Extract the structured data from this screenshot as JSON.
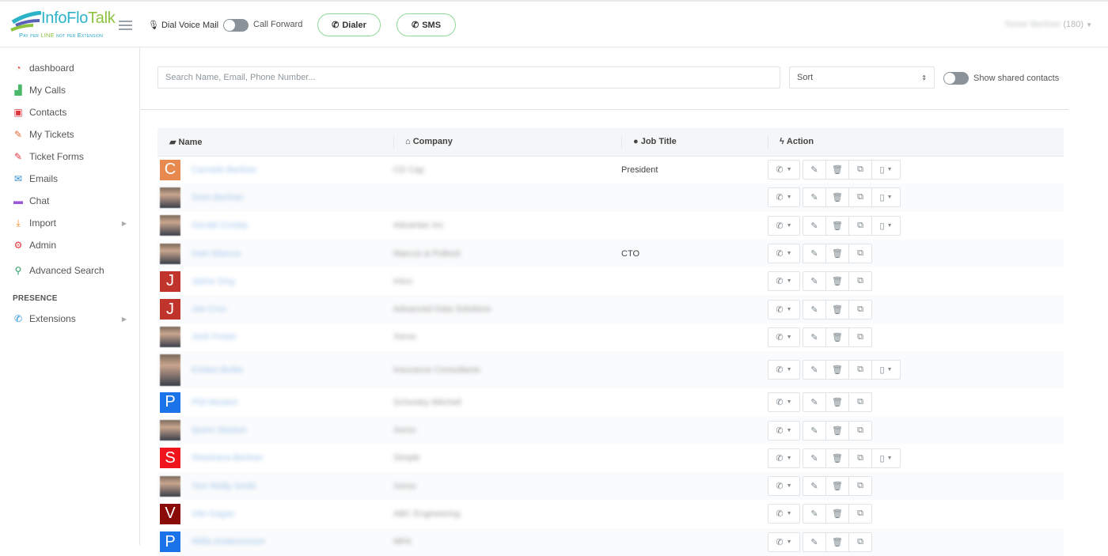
{
  "header": {
    "logo": {
      "brand_main": "InfoFlo",
      "brand_accent": "Talk",
      "tagline_pre": "Pay per ",
      "tagline_accent": "LINE",
      "tagline_post": " not per Extension"
    },
    "dial_voice_mail": "Dial Voice Mail",
    "call_forward": "Call Forward",
    "call_forward_on": false,
    "dialer_label": "Dialer",
    "sms_label": "SMS",
    "user_name": "Tomer Berliner",
    "user_ext": "(180)"
  },
  "sidebar": {
    "items": [
      {
        "label": "dashboard",
        "icon": "dashboard-icon",
        "color": "#e8573f",
        "glyph": "◔"
      },
      {
        "label": "My Calls",
        "icon": "chart-area-icon",
        "color": "#4cb86a",
        "glyph": "▟"
      },
      {
        "label": "Contacts",
        "icon": "contacts-book-icon",
        "color": "#e0343e",
        "glyph": "▣"
      },
      {
        "label": "My Tickets",
        "icon": "ticket-icon",
        "color": "#e06a3a",
        "glyph": "✎"
      },
      {
        "label": "Ticket Forms",
        "icon": "ticket-icon",
        "color": "#e0343e",
        "glyph": "✎"
      },
      {
        "label": "Emails",
        "icon": "envelope-icon",
        "color": "#2e8fd6",
        "glyph": "✉"
      },
      {
        "label": "Chat",
        "icon": "chat-icon",
        "color": "#9b59d8",
        "glyph": "▬"
      },
      {
        "label": "Import",
        "icon": "download-icon",
        "color": "#f08a24",
        "glyph": "⤓",
        "submenu": true
      },
      {
        "label": "Admin",
        "icon": "cogs-icon",
        "color": "#e0343e",
        "glyph": "⚙"
      },
      {
        "label": "Advanced Search",
        "icon": "search-icon",
        "color": "#2aa06a",
        "glyph": "⚲"
      }
    ],
    "section_title": "PRESENCE",
    "presence_items": [
      {
        "label": "Extensions",
        "icon": "phone-icon",
        "color": "#1f8fe0",
        "glyph": "✆",
        "submenu": true
      }
    ]
  },
  "toolbar": {
    "search_placeholder": "Search Name, Email, Phone Number...",
    "search_value": "",
    "sort_label": "Sort",
    "show_shared_label": "Show shared contacts",
    "show_shared_on": false
  },
  "table": {
    "columns": [
      {
        "label": "Name",
        "icon": "book-icon",
        "glyph": "▰"
      },
      {
        "label": "Company",
        "icon": "bank-icon",
        "glyph": "⌂"
      },
      {
        "label": "Job Title",
        "icon": "user-icon",
        "glyph": "●"
      },
      {
        "label": "Action",
        "icon": "bolt-icon",
        "glyph": "ϟ"
      }
    ],
    "rows": [
      {
        "avatar": "C",
        "avatar_color": "#e8894f",
        "name": "Carmelo Berliner",
        "company": "CD Cap",
        "job_title": "President",
        "mobile": true
      },
      {
        "avatar": "",
        "photo": true,
        "name": "Sven Berliner",
        "company": "",
        "job_title": "",
        "mobile": true
      },
      {
        "avatar": "",
        "photo": true,
        "name": "Gerald Crosby",
        "company": "Advantax Inc",
        "job_title": "",
        "mobile": true
      },
      {
        "avatar": "",
        "photo": true,
        "name": "Irwin Marcus",
        "company": "Marcus & Pollock",
        "job_title": "CTO",
        "mobile": false
      },
      {
        "avatar": "J",
        "avatar_color": "#c0342c",
        "name": "Jaime Sing",
        "company": "Intco",
        "job_title": "",
        "mobile": false
      },
      {
        "avatar": "J",
        "avatar_color": "#c0342c",
        "name": "Joe Cruz",
        "company": "Advanced Data Solutions",
        "job_title": "",
        "mobile": false
      },
      {
        "avatar": "",
        "photo": true,
        "name": "Josh Foster",
        "company": "Xerox",
        "job_title": "",
        "mobile": false
      },
      {
        "avatar": "",
        "photo": true,
        "tall": true,
        "name": "Kristen Butler",
        "company": "Insurance Consultants",
        "job_title": "",
        "mobile": true
      },
      {
        "avatar": "P",
        "avatar_color": "#1a73e8",
        "name": "Phil Mostert",
        "company": "Schooley Mitchell",
        "job_title": "",
        "mobile": false
      },
      {
        "avatar": "",
        "photo": true,
        "name": "Quinn Staxton",
        "company": "Xerox",
        "job_title": "",
        "mobile": false
      },
      {
        "avatar": "S",
        "avatar_color": "#f0141e",
        "name": "Shoshana Berliner",
        "company": "Simple",
        "job_title": "",
        "mobile": true
      },
      {
        "avatar": "",
        "photo": true,
        "name": "Tom Reilly Smith",
        "company": "Xerox",
        "job_title": "",
        "mobile": false
      },
      {
        "avatar": "V",
        "avatar_color": "#8b0a0a",
        "name": "Vito Gagan",
        "company": "ABC Engineering",
        "job_title": "",
        "mobile": false
      },
      {
        "avatar": "P",
        "avatar_color": "#1a73e8",
        "name": "Willis Andersonson",
        "company": "MFA",
        "job_title": "",
        "mobile": false
      }
    ]
  },
  "colors": {
    "accent_green": "#8fd99a",
    "toggle_off": "#8a9399",
    "link_blue": "#4a90d9"
  }
}
